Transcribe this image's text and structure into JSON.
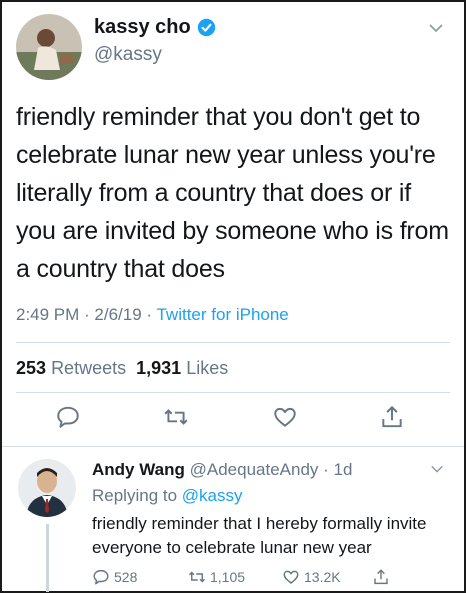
{
  "tweet": {
    "author_name": "kassy cho",
    "author_handle": "@kassy",
    "text": "friendly reminder that you don't get to celebrate lunar new year unless you're literally from a country that does or if you are invited by someone who is from a country that does",
    "time": "2:49 PM · 2/6/19 · ",
    "source": "Twitter for iPhone",
    "retweets_count": "253",
    "retweets_label": "Retweets",
    "likes_count": "1,931",
    "likes_label": "Likes",
    "icons": [
      "reply-icon",
      "retweet-icon",
      "like-icon",
      "share-icon"
    ]
  },
  "reply": {
    "author_name": "Andy Wang",
    "author_handle": "@AdequateAndy",
    "time_ago": " · 1d",
    "replying_to_label": "Replying to ",
    "replying_to_handle": "@kassy",
    "text": "friendly reminder that I hereby formally invite everyone to celebrate lunar new year",
    "reply_count": "528",
    "retweet_count": "1,105",
    "like_count": "13.2K"
  },
  "colors": {
    "accent": "#1da1f2",
    "secondary_text": "#657786",
    "primary_text": "#14171a",
    "divider": "#d9dee2"
  }
}
